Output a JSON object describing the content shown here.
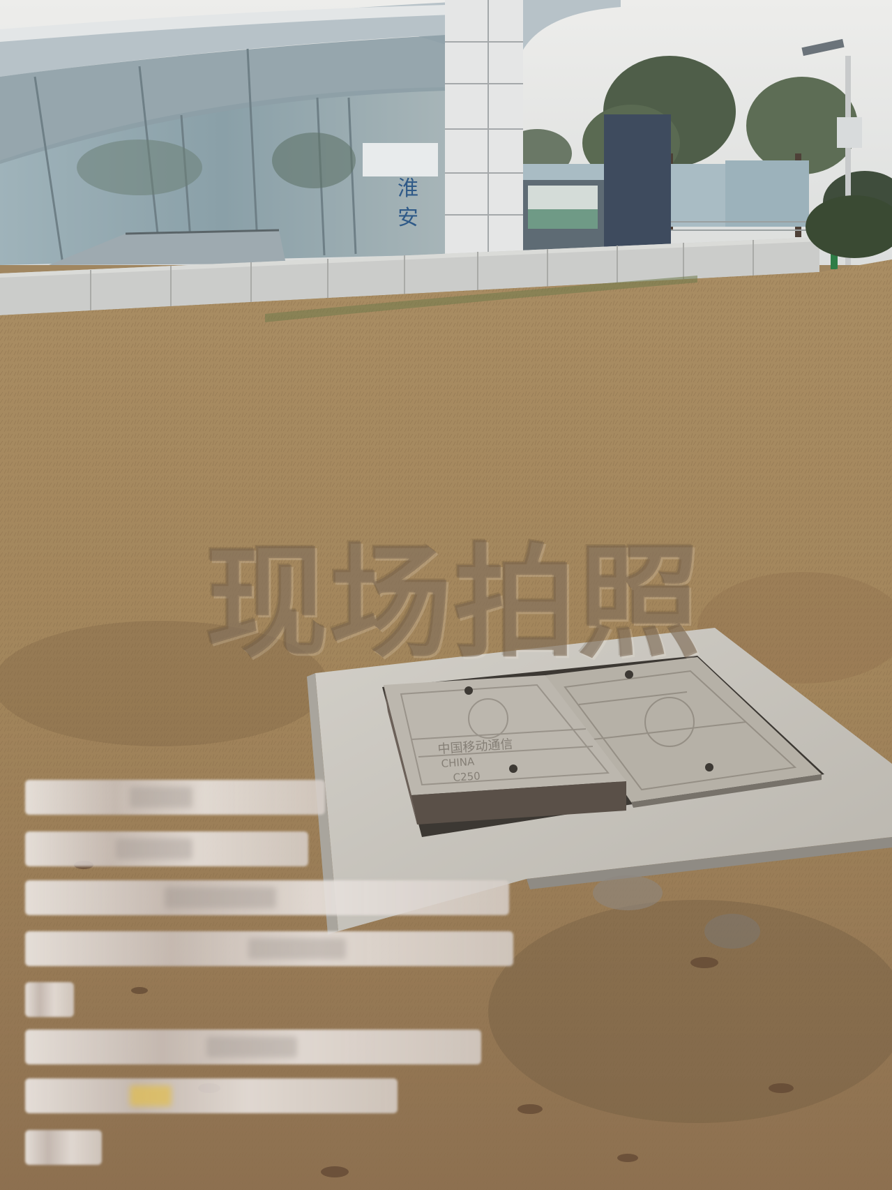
{
  "image": {
    "watermark_text": "现场拍照",
    "corner_watermark_text": "",
    "station_sign_text": "淮安",
    "manhole_cover_text": [
      "中国移动通信",
      "CHINA",
      "C250"
    ]
  },
  "redacted_caption_lines": [
    {
      "id": 1,
      "text": ""
    },
    {
      "id": 2,
      "text": ""
    },
    {
      "id": 3,
      "text": ""
    },
    {
      "id": 4,
      "text": ""
    },
    {
      "id": 5,
      "text": ""
    },
    {
      "id": 6,
      "text": ""
    },
    {
      "id": 7,
      "text": ""
    },
    {
      "id": 8,
      "text": ""
    }
  ],
  "colors": {
    "sky": "#e6e6e4",
    "grass_dry": "#a7895f",
    "grass_dark": "#7d6446",
    "concrete": "#c9c6bf",
    "cover": "#b3aea4",
    "glass": "#8fa5ae"
  }
}
